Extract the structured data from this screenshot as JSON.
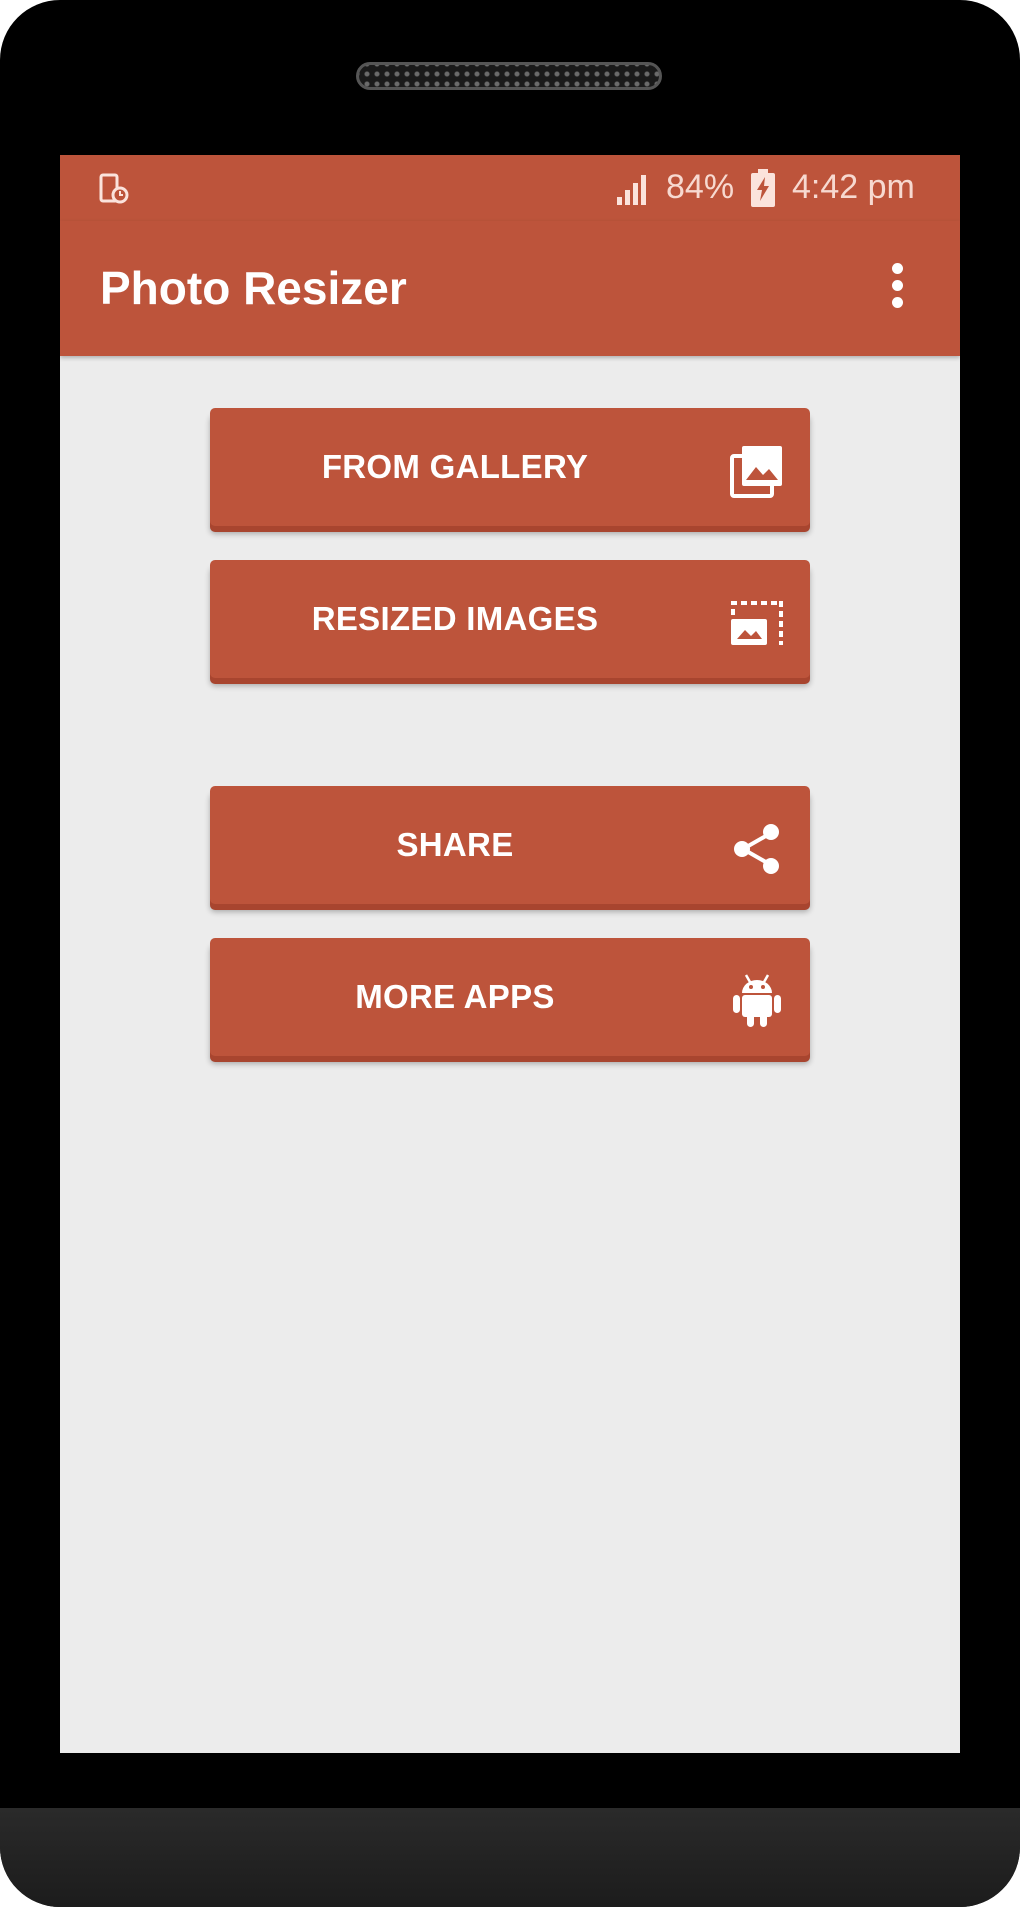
{
  "status_bar": {
    "battery": "84%",
    "time": "4:42 pm"
  },
  "app_bar": {
    "title": "Photo Resizer"
  },
  "buttons": [
    {
      "label": "FROM GALLERY",
      "icon": "gallery-icon"
    },
    {
      "label": "RESIZED IMAGES",
      "icon": "photo-size-select-icon"
    },
    {
      "label": "SHARE",
      "icon": "share-icon"
    },
    {
      "label": "MORE APPS",
      "icon": "android-icon"
    }
  ],
  "colors": {
    "primary": "#bd543b",
    "background": "#ececec"
  }
}
